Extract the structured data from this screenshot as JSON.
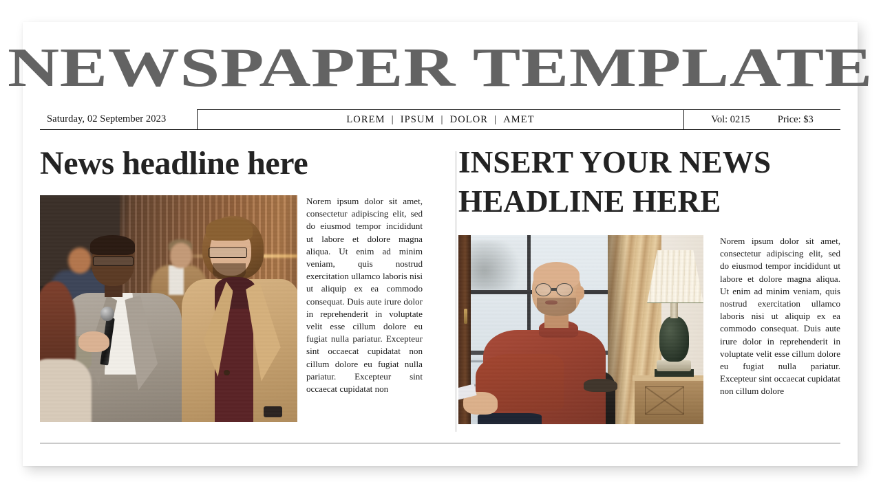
{
  "masthead": {
    "title": "NEWSPAPER TEMPLATE"
  },
  "infobar": {
    "date": "Saturday, 02 September 2023",
    "nav_items": [
      "LOREM",
      "IPSUM",
      "DOLOR",
      "AMET"
    ],
    "separator": "|",
    "volume": "Vol: 0215",
    "price": "Price: $3"
  },
  "articles": {
    "left": {
      "headline": "News headline here",
      "photo_alt": "interview-photo",
      "body": "Norem ipsum dolor sit amet, consectetur adipiscing elit, sed do eiusmod tempor incididunt ut labore et dolore magna aliqua. Ut enim ad minim veniam, quis nostrud exercitation ullamco laboris nisi ut aliquip ex ea commodo consequat. Duis aute irure dolor in reprehenderit in voluptate velit esse cillum dolore eu fugiat nulla pariatur. Excepteur sint occaecat cupidatat non cillum dolore eu fugiat nulla pariatur. Excepteur sint occaecat cupidatat non"
    },
    "right": {
      "headline": "Insert your news headline here",
      "photo_alt": "seated-man-photo",
      "body": "Norem ipsum dolor sit amet, consectetur adipiscing elit, sed do eiusmod tempor incididunt ut labore et dolore magna aliqua. Ut enim ad minim veniam, quis nostrud exercitation ullamco laboris nisi ut aliquip ex ea commodo consequat. Duis aute irure dolor in reprehenderit in voluptate velit esse cillum dolore eu fugiat nulla pariatur. Excepteur sint occaecat cupidatat non cillum dolore"
    }
  },
  "colors": {
    "masthead_gray": "#636363",
    "headline_black": "#232323",
    "rule_gray": "#7e7e7e",
    "divider_gray": "#b9b9b9",
    "page_background": "#ffffff"
  }
}
